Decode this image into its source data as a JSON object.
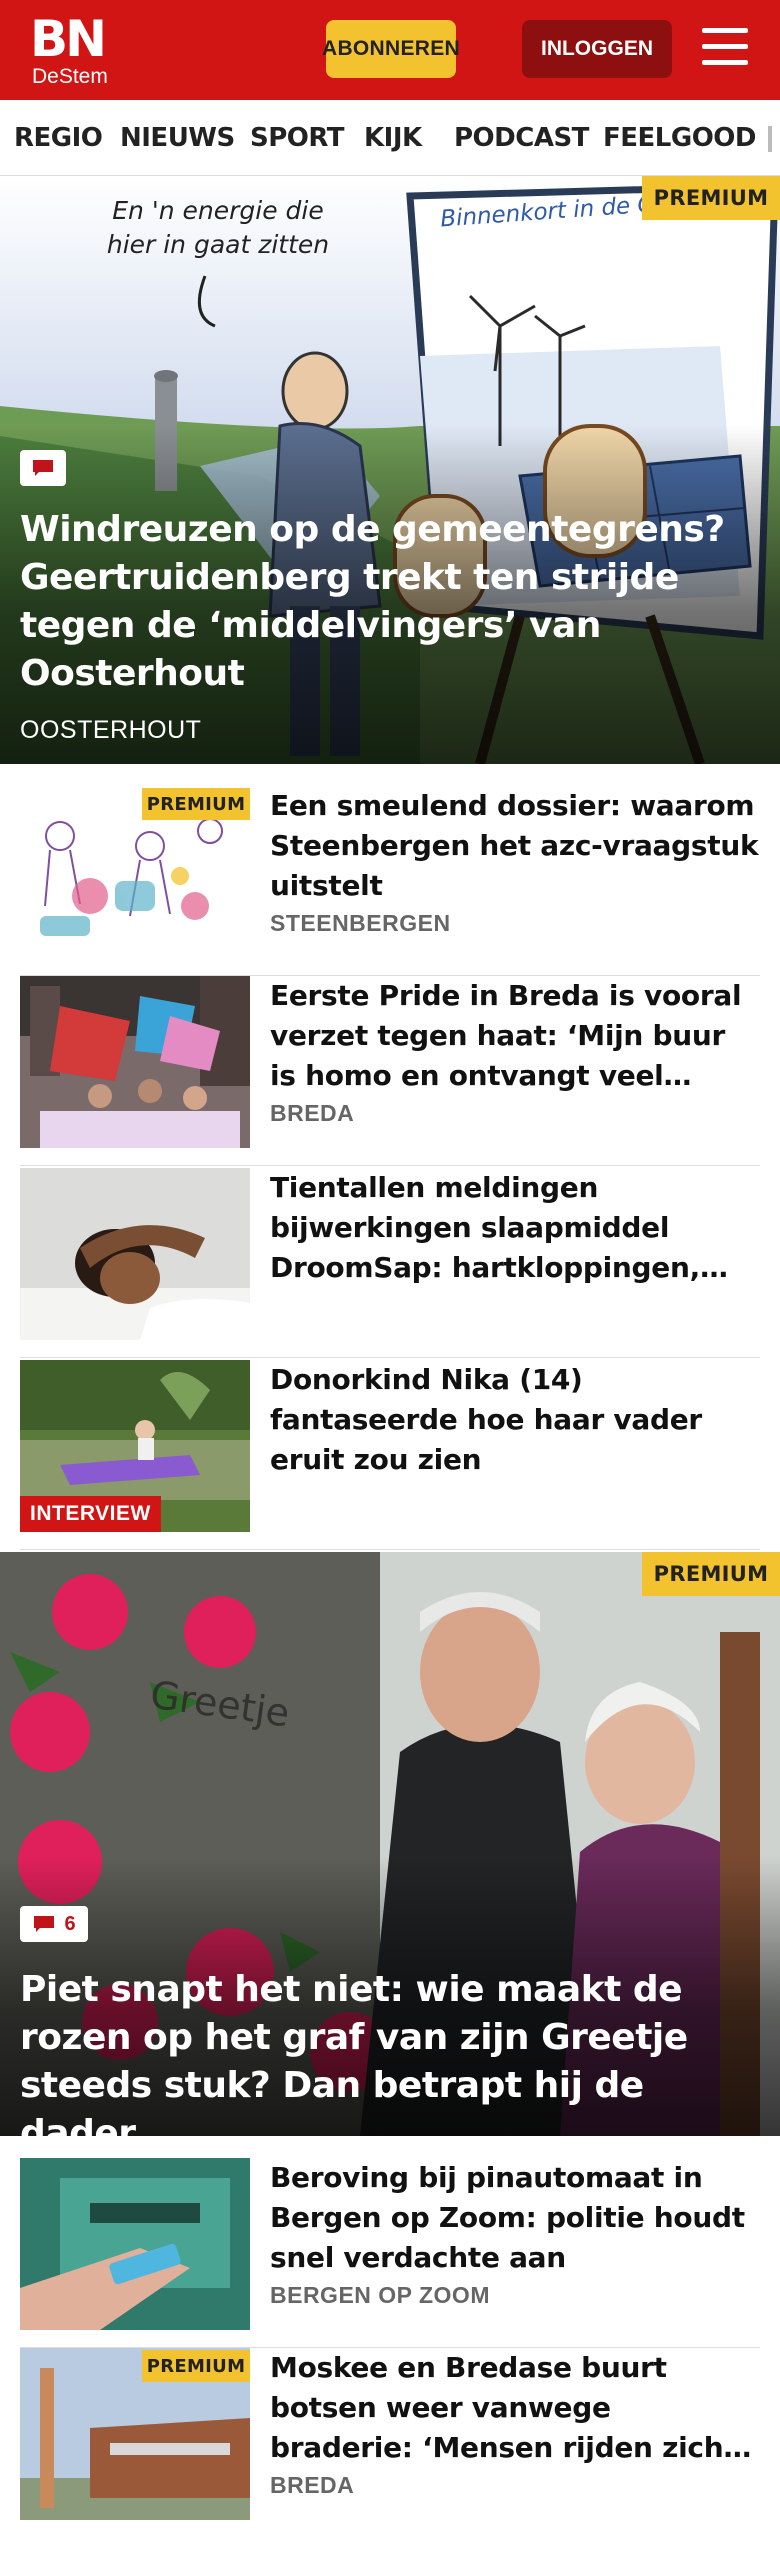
{
  "header": {
    "logo_main": "BN",
    "logo_sub": "DeStem",
    "subscribe_label": "ABONNEREN",
    "login_label": "INLOGGEN"
  },
  "nav": {
    "items": [
      "REGIO",
      "NIEUWS",
      "SPORT",
      "KIJK",
      "PODCAST",
      "FEELGOOD"
    ]
  },
  "hero1": {
    "premium": "PREMIUM",
    "cartoon_caption": "En 'n energie die hier in gaat zitten",
    "sign_text": "Binnenkort in de Oran",
    "title": "Windreuzen op de gemeentegrens? Geertruidenberg trekt ten strijde tegen de ‘middelvingers’ van Oosterhout",
    "category": "OOSTERHOUT"
  },
  "articles1": [
    {
      "title": "Een smeulend dossier: waarom Steenbergen het azc-vraagstuk uitstelt",
      "category": "STEENBERGEN",
      "premium": "PREMIUM"
    },
    {
      "title": "Eerste Pride in Breda is vooral verzet tegen haat: ‘Mijn buur is homo en ontvangt veel bedreigingen’",
      "category": "BREDA"
    },
    {
      "title": "Tientallen meldingen bijwerkingen slaapmiddel DroomSap: hartkloppingen, hallucinaties, nachtmerries",
      "category": ""
    },
    {
      "title": "Donorkind Nika (14) fantaseerde hoe haar vader eruit zou zien",
      "category": "",
      "badge": "INTERVIEW"
    }
  ],
  "hero2": {
    "premium": "PREMIUM",
    "comment_count": "6",
    "title": "Piet snapt het niet: wie maakt de rozen op het graf van zijn Greetje steeds stuk? Dan betrapt hij de dader",
    "stone_text": "Greetje"
  },
  "articles2": [
    {
      "title": "Beroving bij pinautomaat in Bergen op Zoom: politie houdt snel verdachte aan",
      "category": "BERGEN OP ZOOM"
    },
    {
      "title": "Moskee en Bredase buurt botsen weer vanwege braderie: ‘Mensen rijden zich klem in de wijk’",
      "category": "BREDA",
      "premium": "PREMIUM"
    }
  ],
  "colors": {
    "brand_red": "#d11414",
    "premium_yellow": "#f3c22f",
    "login_dark_red": "#8e0f0f"
  }
}
